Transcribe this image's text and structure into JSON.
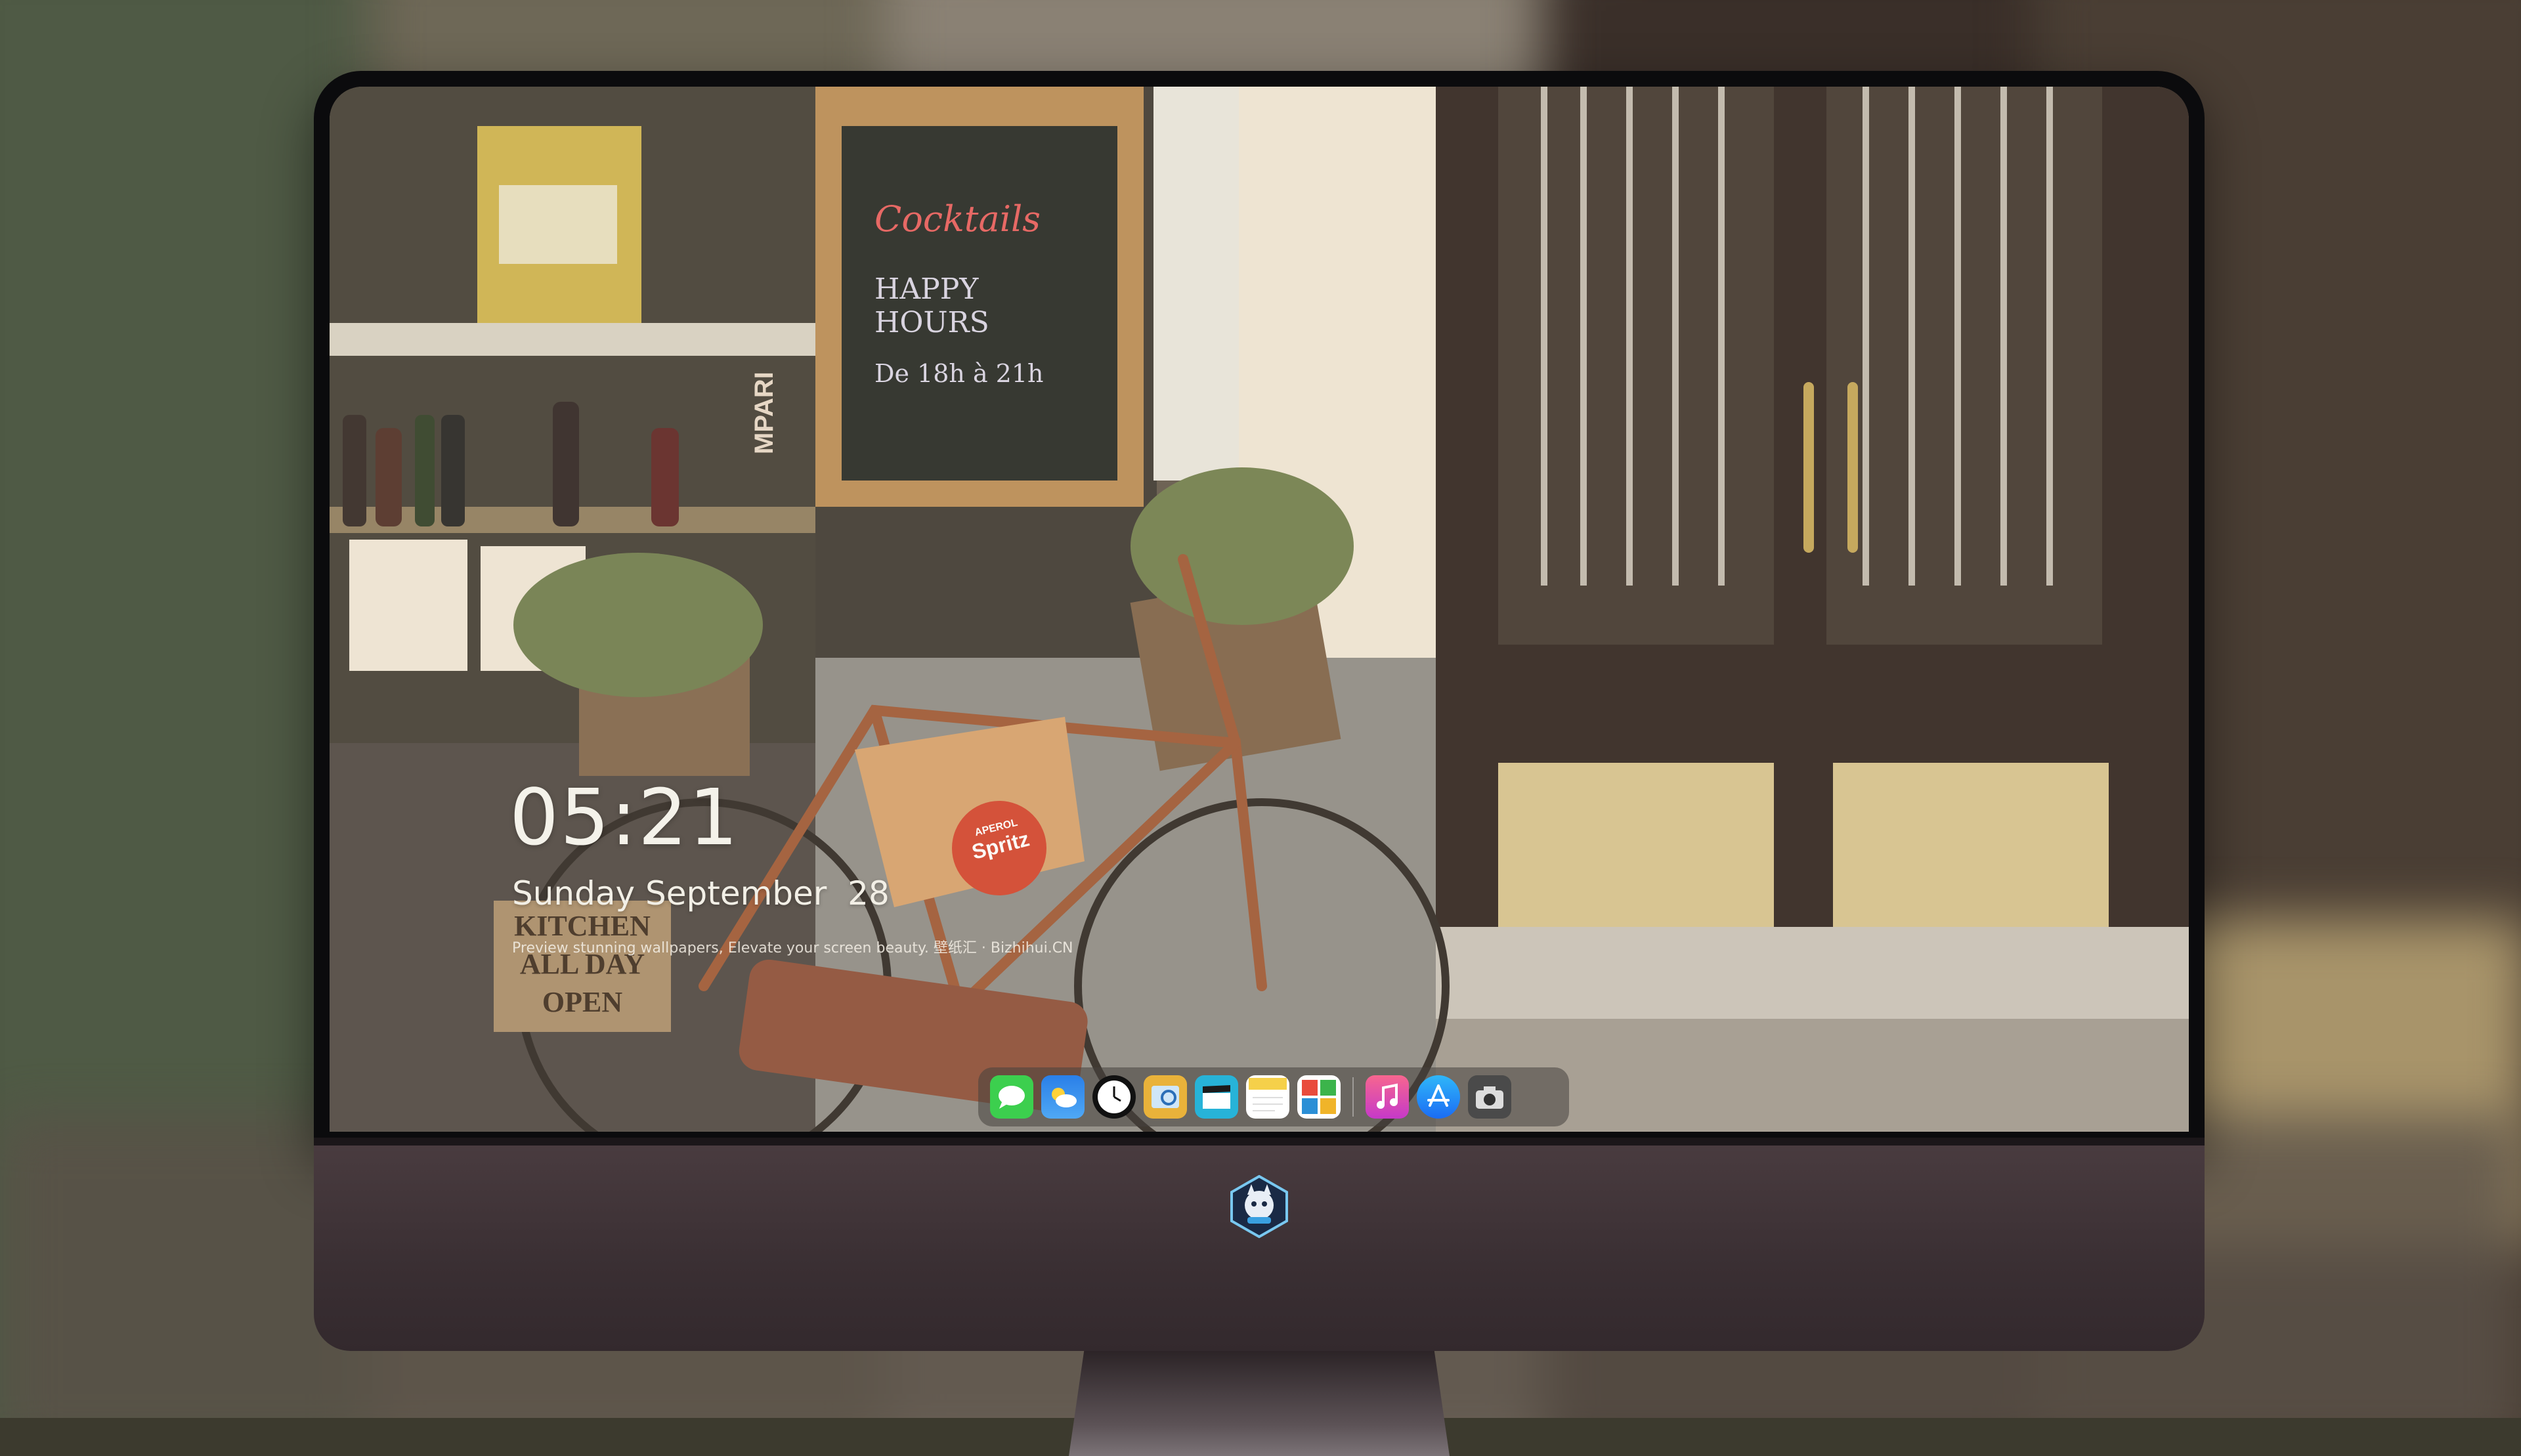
{
  "lock_screen": {
    "time": "05:21",
    "date": "Sunday September  28",
    "tagline": "Preview stunning wallpapers, Elevate your screen beauty. 壁纸汇 · Bizhihui.CN"
  },
  "wallpaper": {
    "sign_lines": [
      "Cocktails",
      "HAPPY HOURS",
      "De 18h à 21h"
    ],
    "board_lines": [
      "KITCHEN",
      "ALL DAY",
      "OPEN"
    ],
    "box_label": [
      "APEROL",
      "Spritz"
    ],
    "poster": "MPARI"
  },
  "dock": {
    "apps": [
      {
        "name": "messages-icon",
        "color": "#3ccf4e"
      },
      {
        "name": "weather-icon",
        "color": "#3b8ff0"
      },
      {
        "name": "clock-icon",
        "color": "#111111"
      },
      {
        "name": "preview-icon",
        "color": "#e9b23a"
      },
      {
        "name": "claquette-icon",
        "color": "#27b3d8"
      },
      {
        "name": "notes-icon",
        "color": "#f5d04a"
      },
      {
        "name": "photo-booth-icon",
        "color": "#2b8fd6"
      },
      {
        "name": "music-icon",
        "color": "#f0509a"
      },
      {
        "name": "app-store-icon",
        "color": "#1b8cf4"
      },
      {
        "name": "camera-icon",
        "color": "#4a4a4a"
      }
    ]
  },
  "colors": {
    "bezel": "#0b0b0d",
    "chin": "#3a2f33",
    "door": "#2b1f1c",
    "wall": "#efe6d6"
  }
}
